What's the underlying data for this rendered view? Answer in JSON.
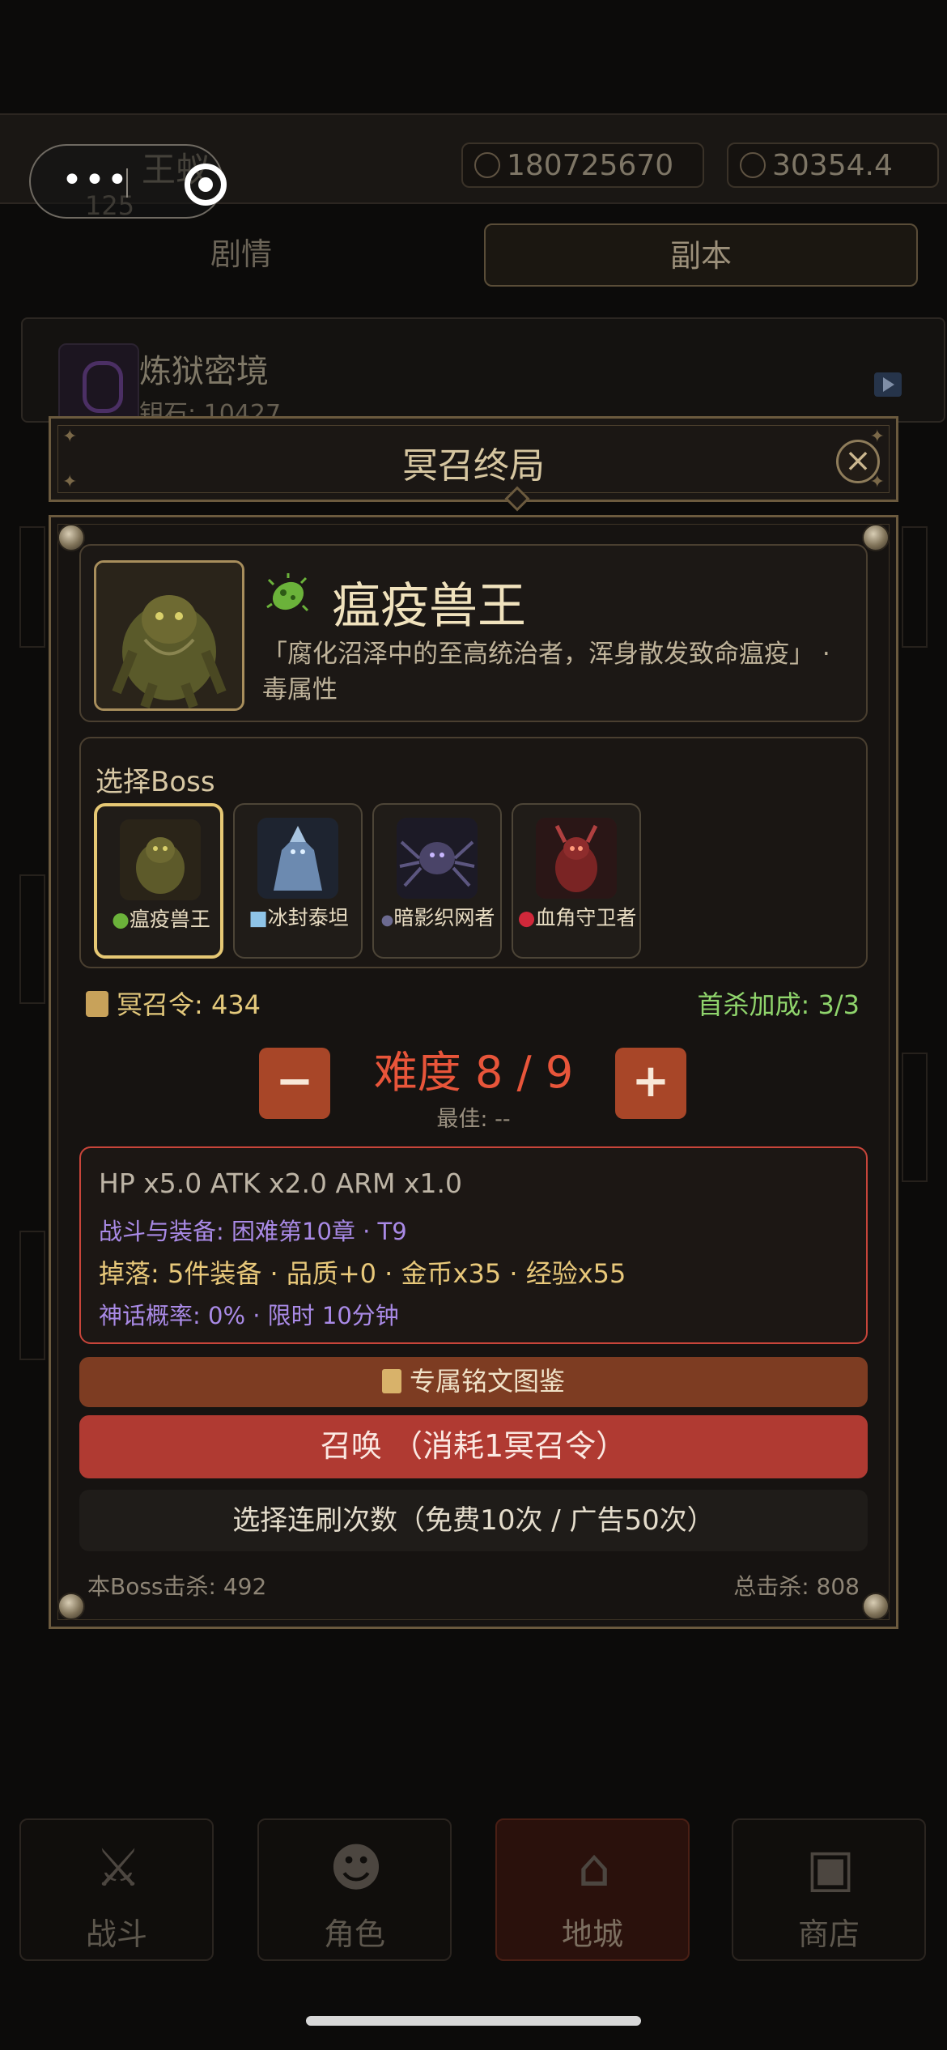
{
  "background": {
    "player_name": "王蚁",
    "level": "125",
    "gold": "180725670",
    "energy": "30354.4",
    "tabs": [
      "剧情",
      "副本"
    ],
    "dungeon": {
      "title": "炼狱密境",
      "subtitle": "钥石: 10427"
    },
    "nav": [
      {
        "label": "战斗",
        "icon": "crossed-swords-icon"
      },
      {
        "label": "角色",
        "icon": "character-mask-icon"
      },
      {
        "label": "地城",
        "icon": "dungeon-gate-icon"
      },
      {
        "label": "商店",
        "icon": "chest-icon"
      }
    ]
  },
  "modal": {
    "title": "冥召终局",
    "close_icon": "×",
    "boss": {
      "name": "瘟疫兽王",
      "description": "「腐化沼泽中的至高统治者，浑身散发致命瘟疫」 · 毒属性",
      "element_icon": "poison-germ-icon"
    },
    "select_label": "选择Boss",
    "boss_options": [
      {
        "label": "瘟疫兽王",
        "icon": "poison-icon",
        "active": true
      },
      {
        "label": "冰封泰坦",
        "icon": "ice-icon",
        "active": false
      },
      {
        "label": "暗影织网者",
        "icon": "shadow-drop-icon",
        "active": false
      },
      {
        "label": "血角守卫者",
        "icon": "blood-drop-icon",
        "active": false
      }
    ],
    "token": "冥召令: 434",
    "first_kill": "首杀加成: 3/3",
    "difficulty": "难度 8 / 9",
    "best": "最佳: --",
    "minus_label": "−",
    "plus_label": "+",
    "stats": {
      "multipliers": "HP x5.0  ATK x2.0  ARM x1.0",
      "battle_gear": "战斗与装备: 困难第10章 · T9",
      "drops": "掉落: 5件装备 · 品质+0 · 金币x35 · 经验x55",
      "mythic": "神话概率: 0%  · 限时 10分钟"
    },
    "buttons": {
      "codex": "专属铭文图鉴",
      "summon": "召唤 （消耗1冥召令）",
      "repeat": "选择连刷次数（免费10次 / 广告50次）"
    },
    "boss_kills": "本Boss击杀: 492",
    "total_kills": "总击杀: 808"
  },
  "colors": {
    "accent_gold": "#e6c874",
    "danger_red": "#b03a32",
    "difficulty_red": "#e8553a",
    "first_kill_green": "#8fd46c",
    "mythic_purple": "#a98ae6"
  }
}
